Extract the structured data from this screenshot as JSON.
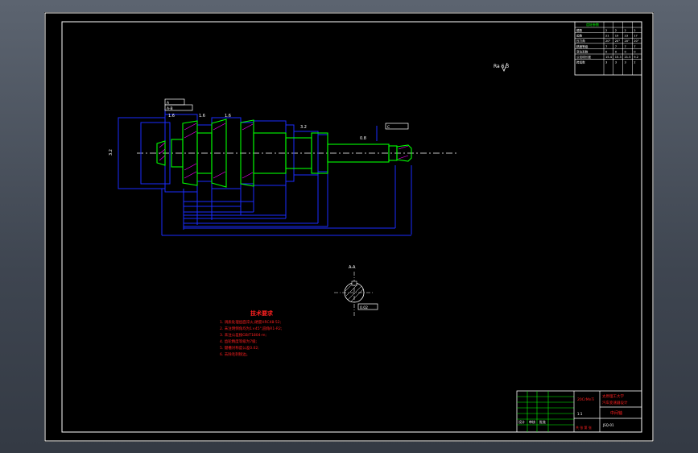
{
  "drawing": {
    "roughness_note": "Ra 6.3",
    "roughness_symbols": [
      "1.6",
      "1.6",
      "1.6",
      "3.2",
      "0.8",
      "3.2"
    ],
    "datum_frames": [
      "A",
      "A-B",
      "C",
      "0.02"
    ],
    "section_label": "A-A",
    "tech_requirements": {
      "title": "技术要求",
      "items": [
        "1. 调质处理齿面淬火,硬度HRC48-52;",
        "2. 未注明倒角均为1×45°,圆角R1-R2;",
        "3. 未注公差按GB/T1804-m;",
        "4. 齿轮精度等级为7级;",
        "5. 键槽对称度公差0.02;",
        "6. 去除毛刺锐边。"
      ]
    },
    "gear_table": {
      "header": "齿轮参数",
      "rows": [
        [
          "模数",
          "2",
          "2",
          "2",
          "2"
        ],
        [
          "齿数",
          "21",
          "19",
          "23",
          "17"
        ],
        [
          "压力角",
          "20°",
          "20°",
          "20°",
          "20°"
        ],
        [
          "精度等级",
          "7",
          "7",
          "7",
          "7"
        ],
        [
          "变位系数",
          "0",
          "0",
          "0",
          "0"
        ],
        [
          "公法线长度",
          "15.4",
          "15.3",
          "21.5",
          "9.2"
        ],
        [
          "跨齿数",
          "3",
          "3",
          "3",
          "2"
        ]
      ]
    },
    "title_block": {
      "company": "太原理工大学",
      "project": "汽车变速器设计",
      "part_name": "中间轴",
      "material": "20CrMnTi",
      "scale": "1:1",
      "drawing_no": "JSQ-01",
      "designer": "设计",
      "checker": "审核",
      "approve": "批准",
      "sheet_note": "共 张 第 张"
    }
  },
  "colors": {
    "background": "#000000",
    "frame": "#ffffff",
    "outline": "#1a2cff",
    "part": "#00ff00",
    "dim": "#ffffff",
    "text_red": "#ff2020",
    "hatch": "#ff00ff",
    "centerline": "#ffffff"
  }
}
